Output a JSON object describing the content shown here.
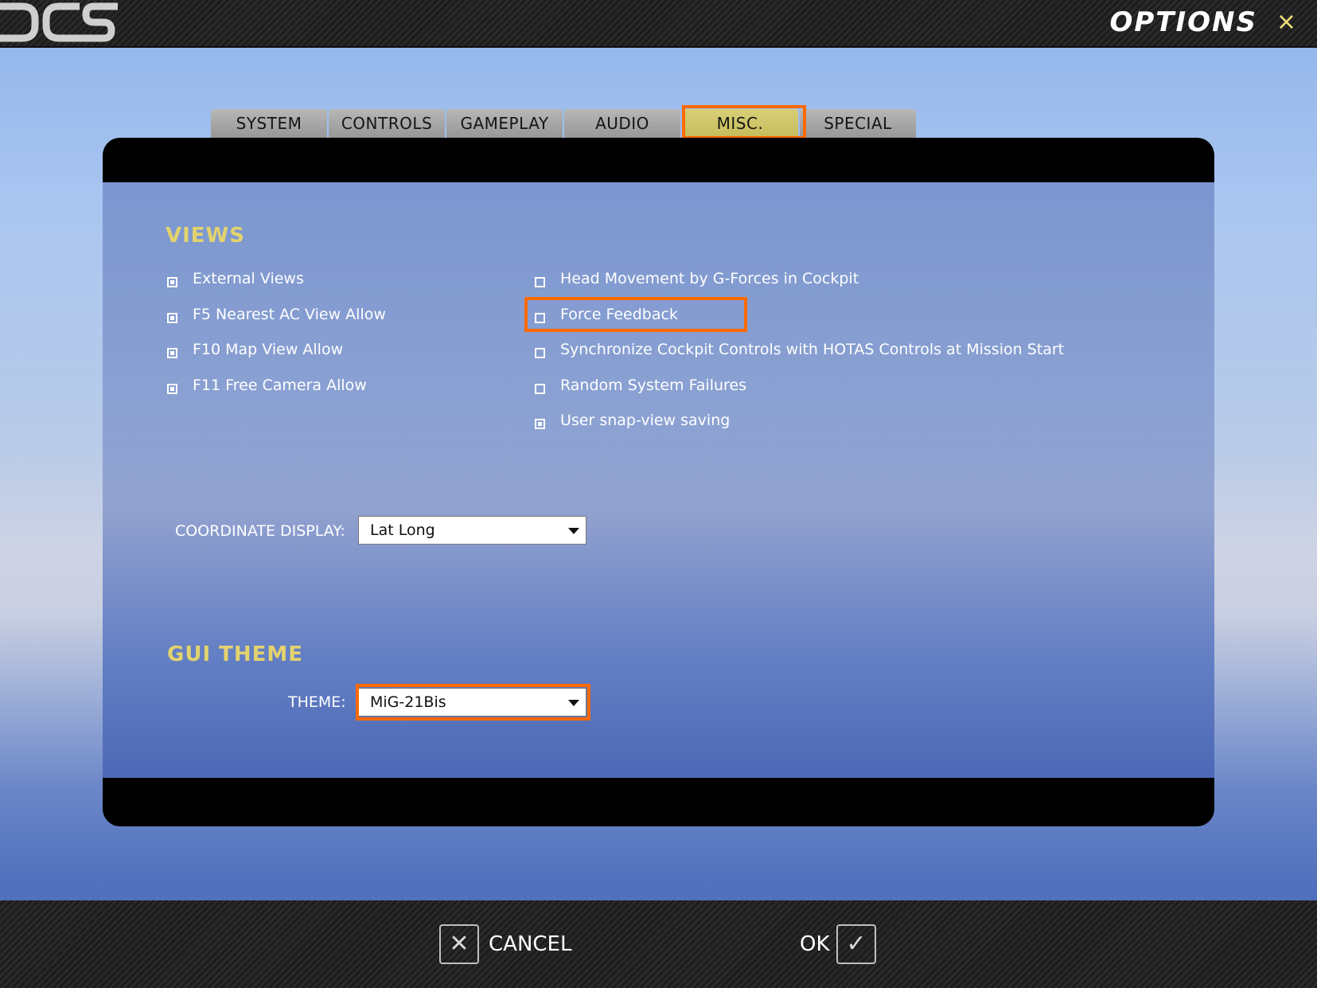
{
  "header": {
    "title": "OPTIONS",
    "close_icon": "×"
  },
  "tabs": [
    {
      "label": "SYSTEM"
    },
    {
      "label": "CONTROLS"
    },
    {
      "label": "GAMEPLAY"
    },
    {
      "label": "AUDIO"
    },
    {
      "label": "MISC.",
      "active": true
    },
    {
      "label": "SPECIAL"
    }
  ],
  "views": {
    "title": "VIEWS",
    "left_options": [
      {
        "label": "External Views",
        "checked": true
      },
      {
        "label": "F5 Nearest AC View Allow",
        "checked": true
      },
      {
        "label": "F10 Map View Allow",
        "checked": true
      },
      {
        "label": "F11 Free Camera Allow",
        "checked": true
      }
    ],
    "right_options": [
      {
        "label": "Head Movement by G-Forces in Cockpit",
        "checked": false
      },
      {
        "label": "Force Feedback",
        "checked": false
      },
      {
        "label": "Synchronize Cockpit Controls with HOTAS Controls at Mission Start",
        "checked": false
      },
      {
        "label": "Random System Failures",
        "checked": false
      },
      {
        "label": "User snap-view saving",
        "checked": true
      }
    ]
  },
  "coordinate_display": {
    "label": "COORDINATE DISPLAY:",
    "value": "Lat Long"
  },
  "gui_theme": {
    "title": "GUI THEME",
    "label": "THEME:",
    "value": "MiG-21Bis"
  },
  "footer": {
    "cancel_label": "CANCEL",
    "cancel_icon": "✕",
    "ok_label": "OK",
    "ok_icon": "✓"
  },
  "colors": {
    "highlight": "#ff6a00",
    "section_title": "#e3d36e",
    "active_tab": "#c6bb5b"
  }
}
